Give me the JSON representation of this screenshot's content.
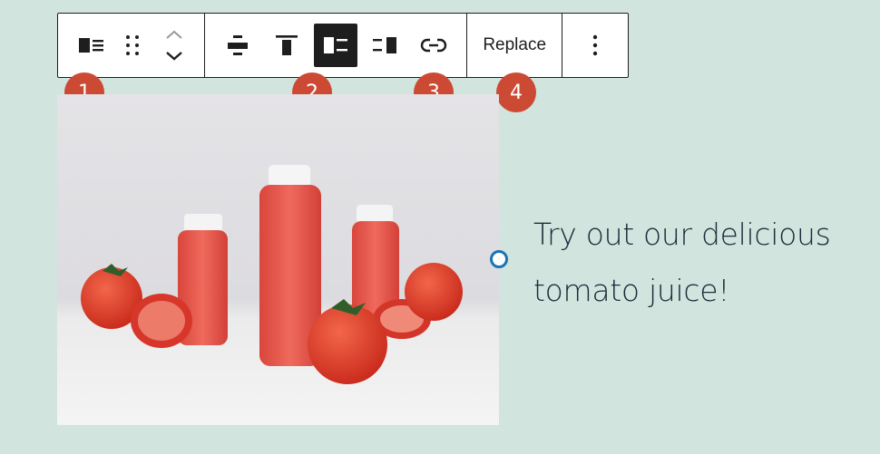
{
  "toolbar": {
    "block_type_icon": "media-text-icon",
    "drag_icon": "drag-handle-icon",
    "move_up_icon": "chevron-up-icon",
    "move_down_icon": "chevron-down-icon",
    "align_icons": [
      "align-center-icon",
      "align-top-icon",
      "media-left-icon",
      "media-right-icon"
    ],
    "link_icon": "link-icon",
    "replace_label": "Replace",
    "more_icon": "more-vertical-icon"
  },
  "badges": [
    "1",
    "2",
    "3",
    "4"
  ],
  "content": {
    "text_line1": "Try out our delicious",
    "text_line2": "tomato juice!"
  },
  "colors": {
    "background": "#d2e4de",
    "badge": "#cc4a34",
    "toolbar_border": "#1e1e1e",
    "handle": "#1a73b5"
  }
}
